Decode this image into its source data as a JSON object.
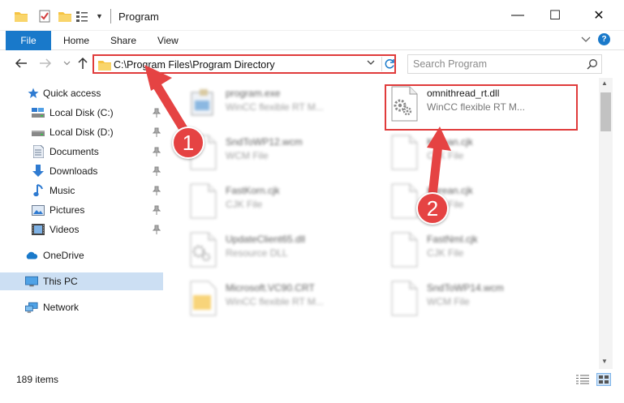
{
  "window": {
    "title": "Program",
    "minimize_glyph": "—",
    "maximize_glyph": "☐",
    "close_glyph": "✕"
  },
  "ribbon": {
    "tabs": [
      {
        "label": "File"
      },
      {
        "label": "Home"
      },
      {
        "label": "Share"
      },
      {
        "label": "View"
      }
    ],
    "help_label": "?"
  },
  "address_bar": {
    "path": "C:\\Program Files\\Program Directory"
  },
  "search": {
    "placeholder": "Search Program"
  },
  "sidebar": {
    "items": [
      {
        "label": "Quick access",
        "icon": "star-icon"
      },
      {
        "label": "Local Disk (C:)",
        "icon": "local-disk-icon",
        "pinned": true
      },
      {
        "label": "Local Disk (D:)",
        "icon": "local-disk-icon",
        "pinned": true
      },
      {
        "label": "Documents",
        "icon": "documents-icon",
        "pinned": true
      },
      {
        "label": "Downloads",
        "icon": "downloads-icon",
        "pinned": true
      },
      {
        "label": "Music",
        "icon": "music-icon",
        "pinned": true
      },
      {
        "label": "Pictures",
        "icon": "pictures-icon",
        "pinned": true
      },
      {
        "label": "Videos",
        "icon": "videos-icon",
        "pinned": true
      },
      {
        "label": "OneDrive",
        "icon": "onedrive-icon"
      },
      {
        "label": "This PC",
        "icon": "this-pc-icon",
        "selected": true
      },
      {
        "label": "Network",
        "icon": "network-icon"
      }
    ]
  },
  "files": [
    {
      "name": "program.exe",
      "desc": "WinCC flexible RT M...",
      "icon": "exe-icon",
      "blurred": true
    },
    {
      "name": "omnithread_rt.dll",
      "desc": "WinCC flexible RT M...",
      "icon": "dll-gear-icon",
      "blurred": false
    },
    {
      "name": "SndToWP12.wcm",
      "desc": "WCM File",
      "icon": "blank-file-icon",
      "blurred": true
    },
    {
      "name": "Korean.cjk",
      "desc": "CJK File",
      "icon": "blank-file-icon",
      "blurred": true
    },
    {
      "name": "FastKorn.cjk",
      "desc": "CJK File",
      "icon": "blank-file-icon",
      "blurred": true
    },
    {
      "name": "Korean.cjk",
      "desc": "CJK File",
      "icon": "blank-file-icon",
      "blurred": true
    },
    {
      "name": "UpdateClient65.dll",
      "desc": "Resource DLL",
      "icon": "dll-gear-icon",
      "blurred": true
    },
    {
      "name": "FastNml.cjk",
      "desc": "CJK File",
      "icon": "blank-file-icon",
      "blurred": true
    },
    {
      "name": "Microsoft.VC90.CRT",
      "desc": "WinCC flexible RT M...",
      "icon": "folder-file-icon",
      "blurred": true
    },
    {
      "name": "SndToWP14.wcm",
      "desc": "WCM File",
      "icon": "blank-file-icon",
      "blurred": true
    }
  ],
  "status_bar": {
    "item_count": "189 items"
  },
  "annotations": [
    {
      "label": "1"
    },
    {
      "label": "2"
    }
  ],
  "colors": {
    "accent": "#1979ca",
    "annotation_red": "#e54343",
    "selected_bg": "#ccdff3",
    "folder_yellow": "#f6c342"
  }
}
